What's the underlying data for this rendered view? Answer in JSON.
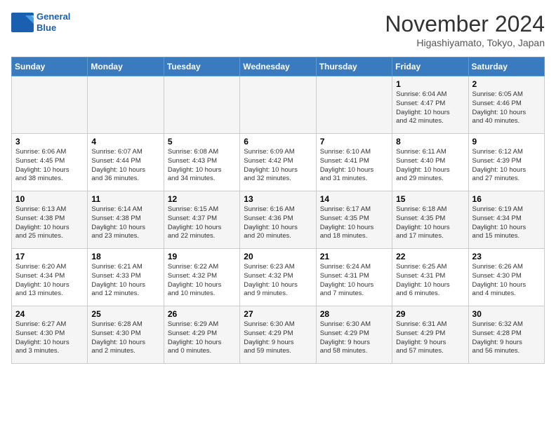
{
  "header": {
    "logo_line1": "General",
    "logo_line2": "Blue",
    "month": "November 2024",
    "location": "Higashiyamato, Tokyo, Japan"
  },
  "weekdays": [
    "Sunday",
    "Monday",
    "Tuesday",
    "Wednesday",
    "Thursday",
    "Friday",
    "Saturday"
  ],
  "weeks": [
    [
      {
        "day": "",
        "info": ""
      },
      {
        "day": "",
        "info": ""
      },
      {
        "day": "",
        "info": ""
      },
      {
        "day": "",
        "info": ""
      },
      {
        "day": "",
        "info": ""
      },
      {
        "day": "1",
        "info": "Sunrise: 6:04 AM\nSunset: 4:47 PM\nDaylight: 10 hours\nand 42 minutes."
      },
      {
        "day": "2",
        "info": "Sunrise: 6:05 AM\nSunset: 4:46 PM\nDaylight: 10 hours\nand 40 minutes."
      }
    ],
    [
      {
        "day": "3",
        "info": "Sunrise: 6:06 AM\nSunset: 4:45 PM\nDaylight: 10 hours\nand 38 minutes."
      },
      {
        "day": "4",
        "info": "Sunrise: 6:07 AM\nSunset: 4:44 PM\nDaylight: 10 hours\nand 36 minutes."
      },
      {
        "day": "5",
        "info": "Sunrise: 6:08 AM\nSunset: 4:43 PM\nDaylight: 10 hours\nand 34 minutes."
      },
      {
        "day": "6",
        "info": "Sunrise: 6:09 AM\nSunset: 4:42 PM\nDaylight: 10 hours\nand 32 minutes."
      },
      {
        "day": "7",
        "info": "Sunrise: 6:10 AM\nSunset: 4:41 PM\nDaylight: 10 hours\nand 31 minutes."
      },
      {
        "day": "8",
        "info": "Sunrise: 6:11 AM\nSunset: 4:40 PM\nDaylight: 10 hours\nand 29 minutes."
      },
      {
        "day": "9",
        "info": "Sunrise: 6:12 AM\nSunset: 4:39 PM\nDaylight: 10 hours\nand 27 minutes."
      }
    ],
    [
      {
        "day": "10",
        "info": "Sunrise: 6:13 AM\nSunset: 4:38 PM\nDaylight: 10 hours\nand 25 minutes."
      },
      {
        "day": "11",
        "info": "Sunrise: 6:14 AM\nSunset: 4:38 PM\nDaylight: 10 hours\nand 23 minutes."
      },
      {
        "day": "12",
        "info": "Sunrise: 6:15 AM\nSunset: 4:37 PM\nDaylight: 10 hours\nand 22 minutes."
      },
      {
        "day": "13",
        "info": "Sunrise: 6:16 AM\nSunset: 4:36 PM\nDaylight: 10 hours\nand 20 minutes."
      },
      {
        "day": "14",
        "info": "Sunrise: 6:17 AM\nSunset: 4:35 PM\nDaylight: 10 hours\nand 18 minutes."
      },
      {
        "day": "15",
        "info": "Sunrise: 6:18 AM\nSunset: 4:35 PM\nDaylight: 10 hours\nand 17 minutes."
      },
      {
        "day": "16",
        "info": "Sunrise: 6:19 AM\nSunset: 4:34 PM\nDaylight: 10 hours\nand 15 minutes."
      }
    ],
    [
      {
        "day": "17",
        "info": "Sunrise: 6:20 AM\nSunset: 4:34 PM\nDaylight: 10 hours\nand 13 minutes."
      },
      {
        "day": "18",
        "info": "Sunrise: 6:21 AM\nSunset: 4:33 PM\nDaylight: 10 hours\nand 12 minutes."
      },
      {
        "day": "19",
        "info": "Sunrise: 6:22 AM\nSunset: 4:32 PM\nDaylight: 10 hours\nand 10 minutes."
      },
      {
        "day": "20",
        "info": "Sunrise: 6:23 AM\nSunset: 4:32 PM\nDaylight: 10 hours\nand 9 minutes."
      },
      {
        "day": "21",
        "info": "Sunrise: 6:24 AM\nSunset: 4:31 PM\nDaylight: 10 hours\nand 7 minutes."
      },
      {
        "day": "22",
        "info": "Sunrise: 6:25 AM\nSunset: 4:31 PM\nDaylight: 10 hours\nand 6 minutes."
      },
      {
        "day": "23",
        "info": "Sunrise: 6:26 AM\nSunset: 4:30 PM\nDaylight: 10 hours\nand 4 minutes."
      }
    ],
    [
      {
        "day": "24",
        "info": "Sunrise: 6:27 AM\nSunset: 4:30 PM\nDaylight: 10 hours\nand 3 minutes."
      },
      {
        "day": "25",
        "info": "Sunrise: 6:28 AM\nSunset: 4:30 PM\nDaylight: 10 hours\nand 2 minutes."
      },
      {
        "day": "26",
        "info": "Sunrise: 6:29 AM\nSunset: 4:29 PM\nDaylight: 10 hours\nand 0 minutes."
      },
      {
        "day": "27",
        "info": "Sunrise: 6:30 AM\nSunset: 4:29 PM\nDaylight: 9 hours\nand 59 minutes."
      },
      {
        "day": "28",
        "info": "Sunrise: 6:30 AM\nSunset: 4:29 PM\nDaylight: 9 hours\nand 58 minutes."
      },
      {
        "day": "29",
        "info": "Sunrise: 6:31 AM\nSunset: 4:29 PM\nDaylight: 9 hours\nand 57 minutes."
      },
      {
        "day": "30",
        "info": "Sunrise: 6:32 AM\nSunset: 4:28 PM\nDaylight: 9 hours\nand 56 minutes."
      }
    ]
  ]
}
